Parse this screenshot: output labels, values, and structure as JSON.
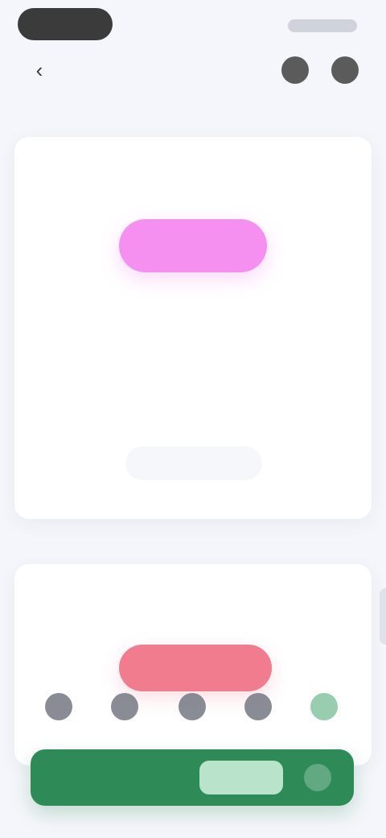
{
  "status_bar": {
    "right_indicator": ""
  },
  "app_bar": {
    "back_glyph": "‹",
    "link_text": "",
    "link_sub": "",
    "right_muted": ""
  },
  "card_main": {
    "label": "",
    "desc_line_1": "",
    "desc_line_2": "",
    "action_label": ""
  },
  "section": {
    "title": "",
    "muted": "",
    "right": ""
  },
  "card_secondary": {
    "label": ""
  },
  "cta": {
    "left_label": "",
    "middle_label": ""
  },
  "colors": {
    "accent_magenta": "#f58ff0",
    "accent_red": "#f07c8e",
    "accent_green": "#2e8b57",
    "accent_green_light": "#b9e3cb"
  }
}
